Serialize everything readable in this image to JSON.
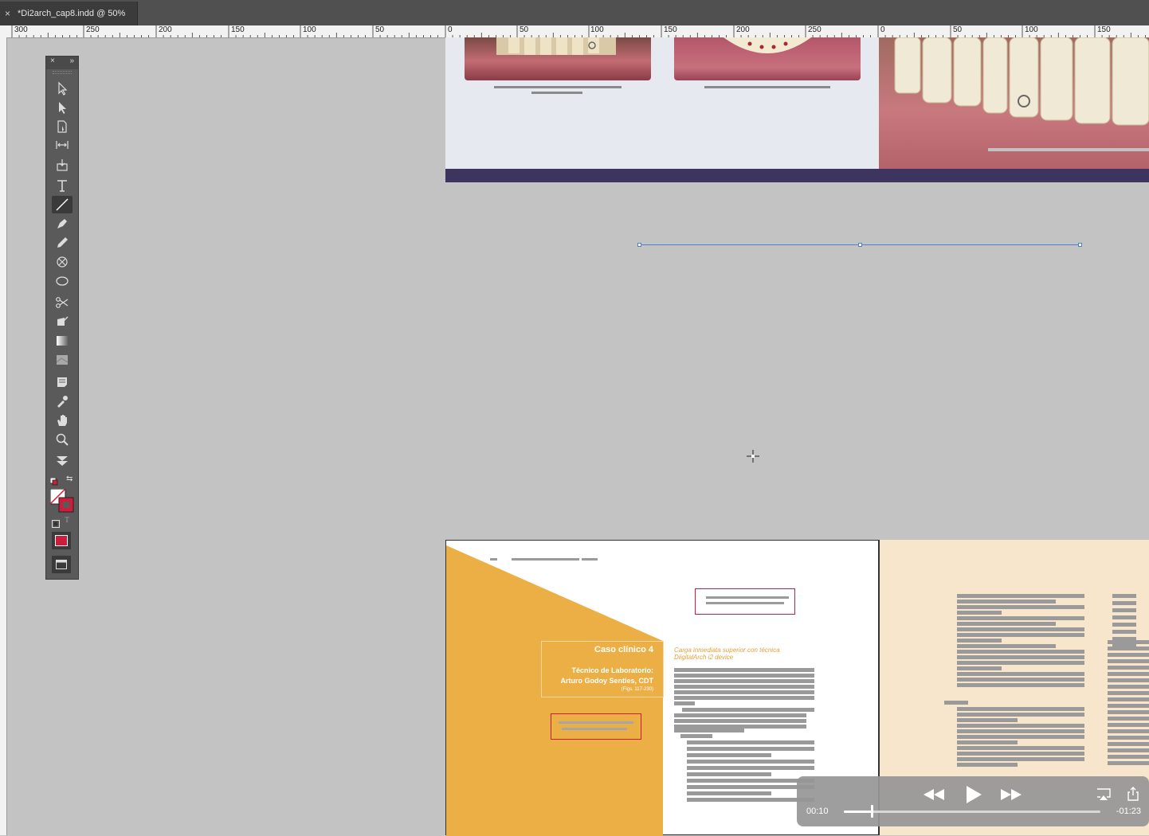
{
  "tab": {
    "close_glyph": "×",
    "title": "*Di2arch_cap8.indd @ 50%"
  },
  "ruler": {
    "labels_left": [
      "300",
      "250",
      "200",
      "150",
      "100",
      "50",
      "0",
      "50",
      "100",
      "150",
      "200",
      "250"
    ],
    "labels_right": [
      "0",
      "50",
      "100",
      "150"
    ]
  },
  "tools_panel": {
    "close_glyph": "×",
    "collapse_glyph": "»",
    "tools": [
      "selection-tool-icon",
      "direct-selection-tool-icon",
      "page-tool-icon",
      "gap-tool-icon",
      "content-collector-icon",
      "type-tool-icon",
      "line-tool-icon",
      "pen-tool-icon",
      "pencil-tool-icon",
      "rectangle-frame-tool-icon",
      "ellipse-tool-icon",
      "scissors-tool-icon",
      "free-transform-tool-icon",
      "gradient-swatch-tool-icon",
      "gradient-feather-tool-icon",
      "note-tool-icon",
      "eyedropper-tool-icon",
      "hand-tool-icon",
      "zoom-tool-icon",
      "more-tools-icon"
    ],
    "fill_color": "#d01c3b",
    "type_glyph": "T"
  },
  "document": {
    "case_title": "Caso clínico 4",
    "case_role": "Técnico de Laboratorio:",
    "case_author": "Arturo Godoy Senties, CDT",
    "case_figs": "(Figs. 117-230)",
    "orange_heading_line1": "Carga inmediata superior con técnica",
    "orange_heading_line2": "DiigitalArch i2 device"
  },
  "video": {
    "current_time": "00:10",
    "remaining_time": "-01:23",
    "progress_fraction": 0.11
  },
  "colors": {
    "orange_page": "#ecaf46",
    "band": "#3d3460",
    "guide": "#4d7fd6",
    "accent_red": "#d01c3b"
  }
}
